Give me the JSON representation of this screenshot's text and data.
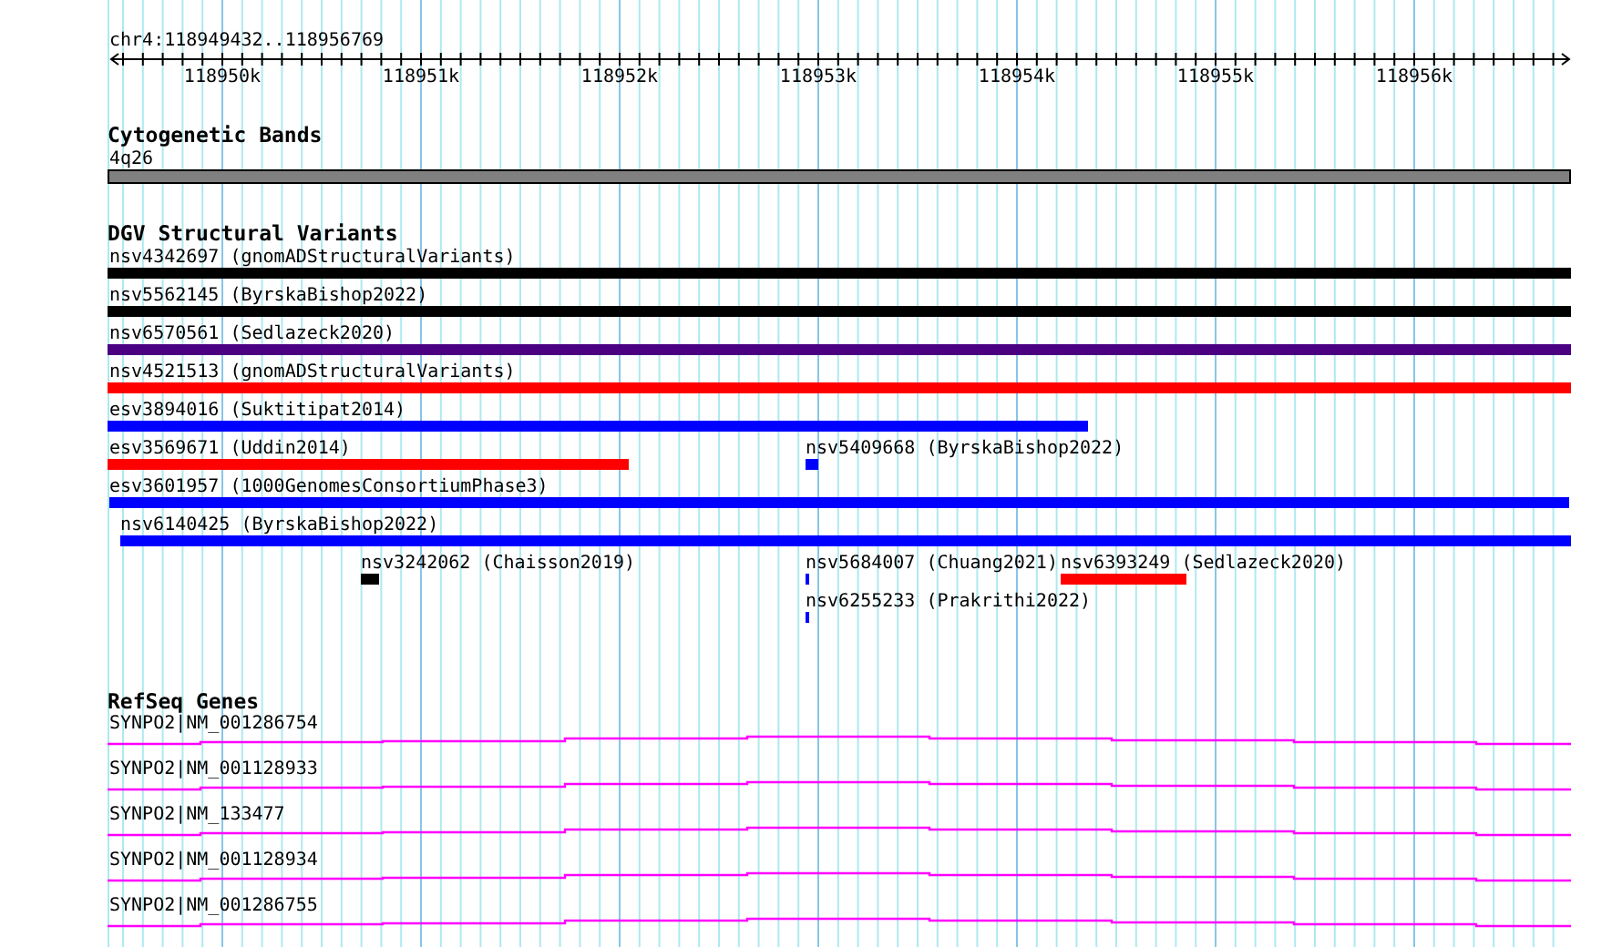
{
  "location": "chr4:118949432..118956769",
  "ruler": {
    "ticks": [
      "118950k",
      "118951k",
      "118952k",
      "118953k",
      "118954k",
      "118955k",
      "118956k"
    ]
  },
  "tracks": [
    {
      "kind": "bands",
      "title": "Cytogenetic Bands",
      "features": [
        {
          "label": "4q26"
        }
      ]
    },
    {
      "kind": "variants",
      "title": "DGV Structural Variants",
      "features": [
        {
          "label": "nsv4342697 (gnomADStructuralVariants)",
          "color": "#000000"
        },
        {
          "label": "nsv5562145 (ByrskaBishop2022)",
          "color": "#000000"
        },
        {
          "label": "nsv6570561 (Sedlazeck2020)",
          "color": "#4b0082"
        },
        {
          "label": "nsv4521513 (gnomADStructuralVariants)",
          "color": "#ff0000"
        },
        {
          "label": "esv3894016 (Suktitipat2014)",
          "color": "#0000ff"
        },
        {
          "label": "esv3569671 (Uddin2014)",
          "color": "#ff0000"
        },
        {
          "label": "nsv5409668 (ByrskaBishop2022)",
          "color": "#0000ff"
        },
        {
          "label": "esv3601957 (1000GenomesConsortiumPhase3)",
          "color": "#0000ff"
        },
        {
          "label": "nsv6140425 (ByrskaBishop2022)",
          "color": "#0000ff"
        },
        {
          "label": "nsv3242062 (Chaisson2019)",
          "color": "#000000"
        },
        {
          "label": "nsv5684007 (Chuang2021)",
          "color": "#0000ff"
        },
        {
          "label": "nsv6393249 (Sedlazeck2020)",
          "color": "#ff0000"
        },
        {
          "label": "nsv6255233 (Prakrithi2022)",
          "color": "#0000ff"
        }
      ]
    },
    {
      "kind": "genes",
      "title": "RefSeq Genes",
      "features": [
        {
          "label": "SYNPO2|NM_001286754"
        },
        {
          "label": "SYNPO2|NM_001128933"
        },
        {
          "label": "SYNPO2|NM_133477"
        },
        {
          "label": "SYNPO2|NM_001128934"
        },
        {
          "label": "SYNPO2|NM_001286755"
        }
      ]
    }
  ]
}
